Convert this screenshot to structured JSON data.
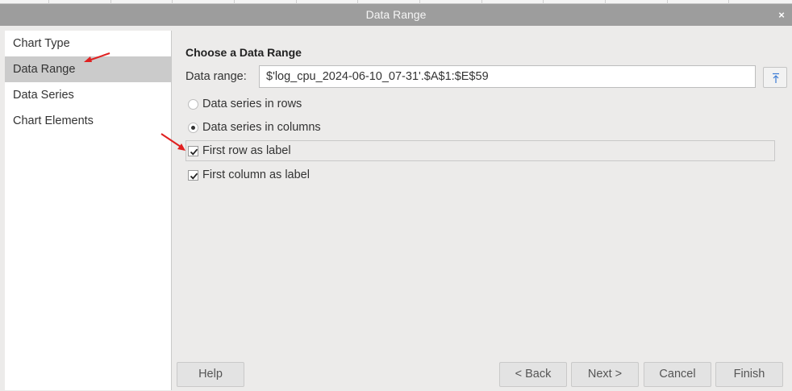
{
  "dialog": {
    "title": "Data Range",
    "close_glyph": "×"
  },
  "sidebar": {
    "items": [
      {
        "label": "Chart Type",
        "active": false
      },
      {
        "label": "Data Range",
        "active": true
      },
      {
        "label": "Data Series",
        "active": false
      },
      {
        "label": "Chart Elements",
        "active": false
      }
    ]
  },
  "main": {
    "section_title": "Choose a Data Range",
    "range_label": "Data range:",
    "range_value": "$'log_cpu_2024-06-10_07-31'.$A$1:$E$59",
    "shrink_icon": "shrink-collapse-icon",
    "options": {
      "rows": {
        "label": "Data series in rows",
        "selected": false
      },
      "columns": {
        "label": "Data series in columns",
        "selected": true
      },
      "first_row": {
        "label": "First row as label",
        "checked": true
      },
      "first_column": {
        "label": "First column as label",
        "checked": true
      }
    }
  },
  "buttons": {
    "help": "Help",
    "back": "< Back",
    "next": "Next >",
    "cancel": "Cancel",
    "finish": "Finish"
  },
  "annotations": {
    "arrow_color": "#e02020"
  }
}
